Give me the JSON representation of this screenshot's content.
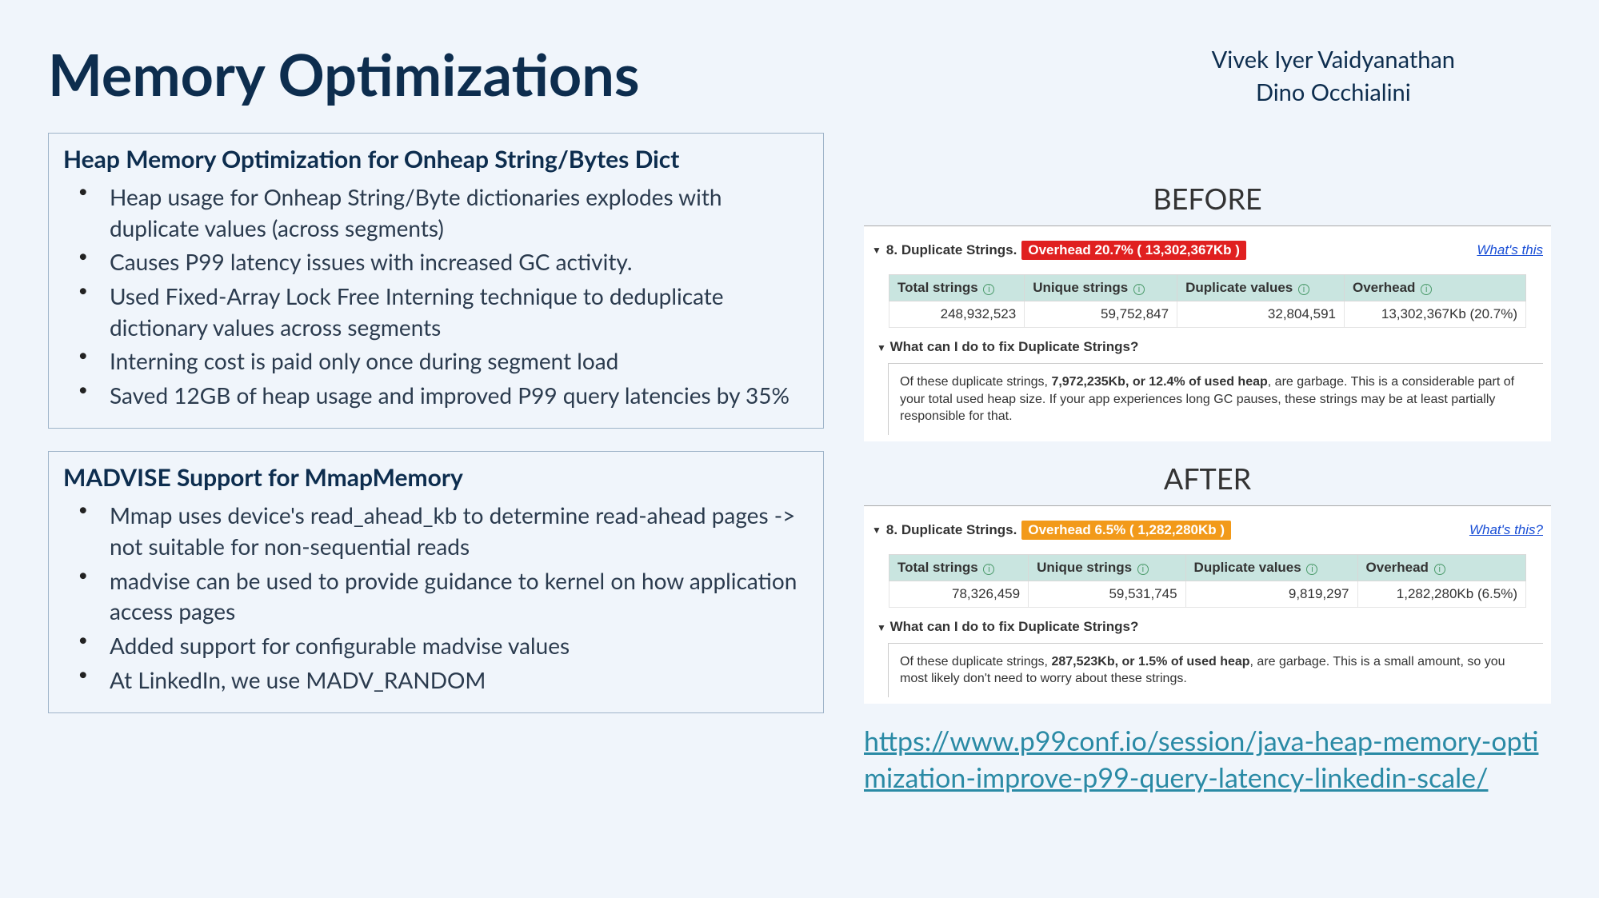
{
  "title": "Memory Optimizations",
  "authors": [
    "Vivek Iyer Vaidyanathan",
    "Dino Occhialini"
  ],
  "box1": {
    "title": "Heap Memory Optimization for Onheap String/Bytes Dict",
    "items": [
      "Heap usage for Onheap String/Byte dictionaries explodes with duplicate values (across segments)",
      "Causes P99 latency issues with increased GC activity.",
      "Used Fixed-Array Lock Free Interning technique to deduplicate dictionary values across segments",
      "Interning cost is paid only once during segment load",
      "Saved 12GB of heap usage and improved P99 query latencies by 35%"
    ]
  },
  "box2": {
    "title": "MADVISE Support for MmapMemory",
    "items": [
      "Mmap uses device's read_ahead_kb to determine read-ahead pages -> not suitable for non-sequential reads",
      "madvise can be used to provide guidance to kernel on how application access pages",
      "Added support for configurable madvise values",
      "At LinkedIn, we use MADV_RANDOM"
    ]
  },
  "before": {
    "label": "BEFORE",
    "section_number": "8.",
    "section_title": "Duplicate Strings.",
    "badge": "Overhead 20.7%  ( 13,302,367Kb )",
    "whats_this": "What's this",
    "table": {
      "headers": [
        "Total strings",
        "Unique strings",
        "Duplicate values",
        "Overhead"
      ],
      "row": [
        "248,932,523",
        "59,752,847",
        "32,804,591",
        "13,302,367Kb (20.7%)"
      ]
    },
    "fix_header": "What can I do to fix Duplicate Strings?",
    "fix_text_prefix": "Of these duplicate strings, ",
    "fix_text_bold": "7,972,235Kb, or 12.4% of used heap",
    "fix_text_suffix": ", are garbage. This is a considerable part of your total used heap size. If your app experiences long GC pauses, these strings may be at least partially responsible for that."
  },
  "after": {
    "label": "AFTER",
    "section_number": "8.",
    "section_title": "Duplicate Strings.",
    "badge": "Overhead 6.5%  ( 1,282,280Kb )",
    "whats_this": "What's this?",
    "table": {
      "headers": [
        "Total strings",
        "Unique strings",
        "Duplicate values",
        "Overhead"
      ],
      "row": [
        "78,326,459",
        "59,531,745",
        "9,819,297",
        "1,282,280Kb (6.5%)"
      ]
    },
    "fix_header": "What can I do to fix Duplicate Strings?",
    "fix_text_prefix": "Of these duplicate strings, ",
    "fix_text_bold": "287,523Kb, or 1.5% of used heap",
    "fix_text_suffix": ", are garbage. This is a small amount, so you most likely don't need to worry about these strings."
  },
  "link": "https://www.p99conf.io/session/java-heap-memory-optimization-improve-p99-query-latency-linkedin-scale/"
}
